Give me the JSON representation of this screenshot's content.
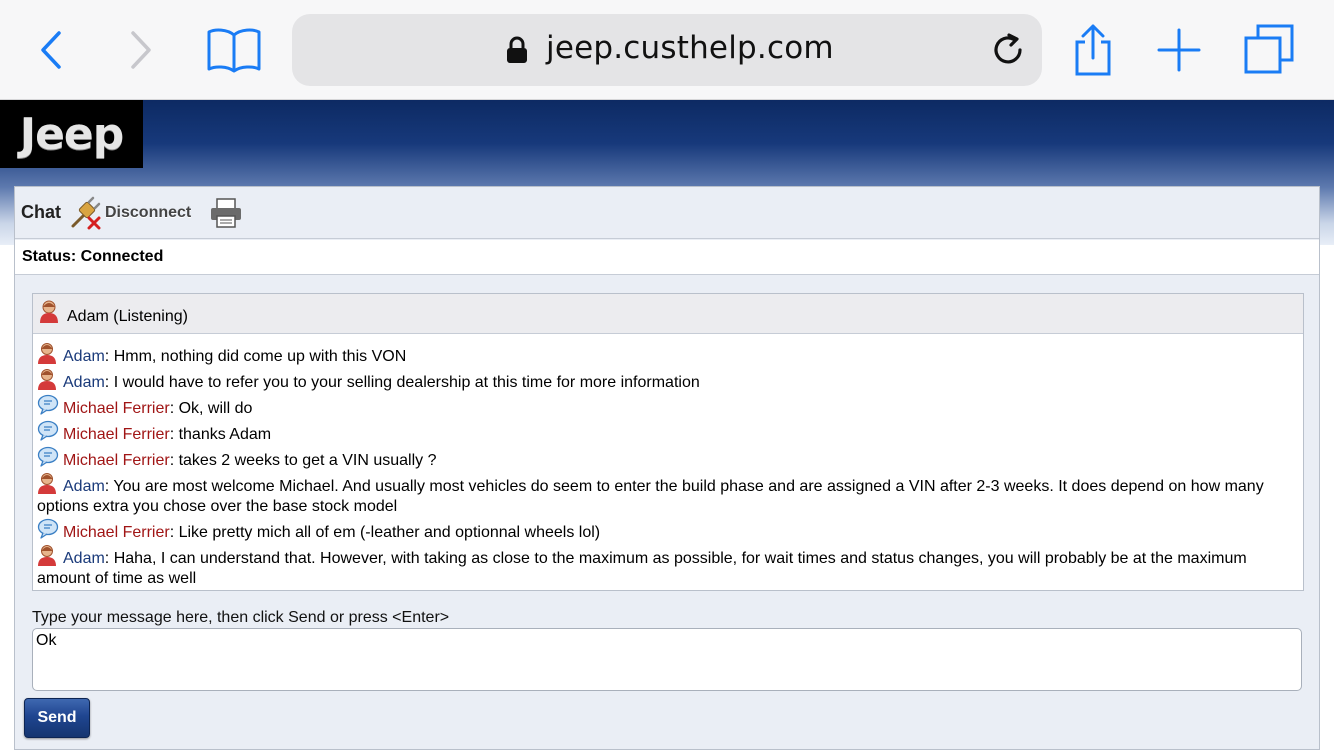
{
  "browser": {
    "url": "jeep.custhelp.com",
    "accent": "#1a7cf5"
  },
  "site": {
    "logo_text": "Jeep"
  },
  "toolbar": {
    "chat_label": "Chat",
    "disconnect_label": "Disconnect"
  },
  "status": {
    "text": "Status: Connected"
  },
  "agent_header": {
    "label": "Adam (Listening)"
  },
  "messages": [
    {
      "sender": "Adam",
      "role": "agent",
      "text": ": Hmm, nothing did come up with this VON"
    },
    {
      "sender": "Adam",
      "role": "agent",
      "text": ": I would have to refer you to your selling dealership at this time for more information"
    },
    {
      "sender": "Michael Ferrier",
      "role": "user",
      "text": ": Ok, will do"
    },
    {
      "sender": "Michael Ferrier",
      "role": "user",
      "text": ": thanks Adam"
    },
    {
      "sender": "Michael Ferrier",
      "role": "user",
      "text": ": takes 2 weeks to get a VIN usually ?"
    },
    {
      "sender": "Adam",
      "role": "agent",
      "text": ": You are most welcome Michael. And usually most vehicles do seem to enter the build phase and are assigned a VIN after 2-3 weeks. It does depend on how many options extra you chose over the base stock model"
    },
    {
      "sender": "Michael Ferrier",
      "role": "user",
      "text": ": Like pretty mich all of em (-leather and optionnal wheels lol)"
    },
    {
      "sender": "Adam",
      "role": "agent",
      "text": ": Haha, I can understand that. However, with taking as close to the maximum as possible, for wait times and status changes, you will probably be at the maximum amount of time as well"
    }
  ],
  "compose": {
    "prompt": "Type your message here, then click Send or press <Enter>",
    "value": "Ok",
    "send_label": "Send"
  },
  "colors": {
    "agent_name": "#1a3a7a",
    "user_name": "#a01515",
    "send_button": "#1f4590"
  }
}
